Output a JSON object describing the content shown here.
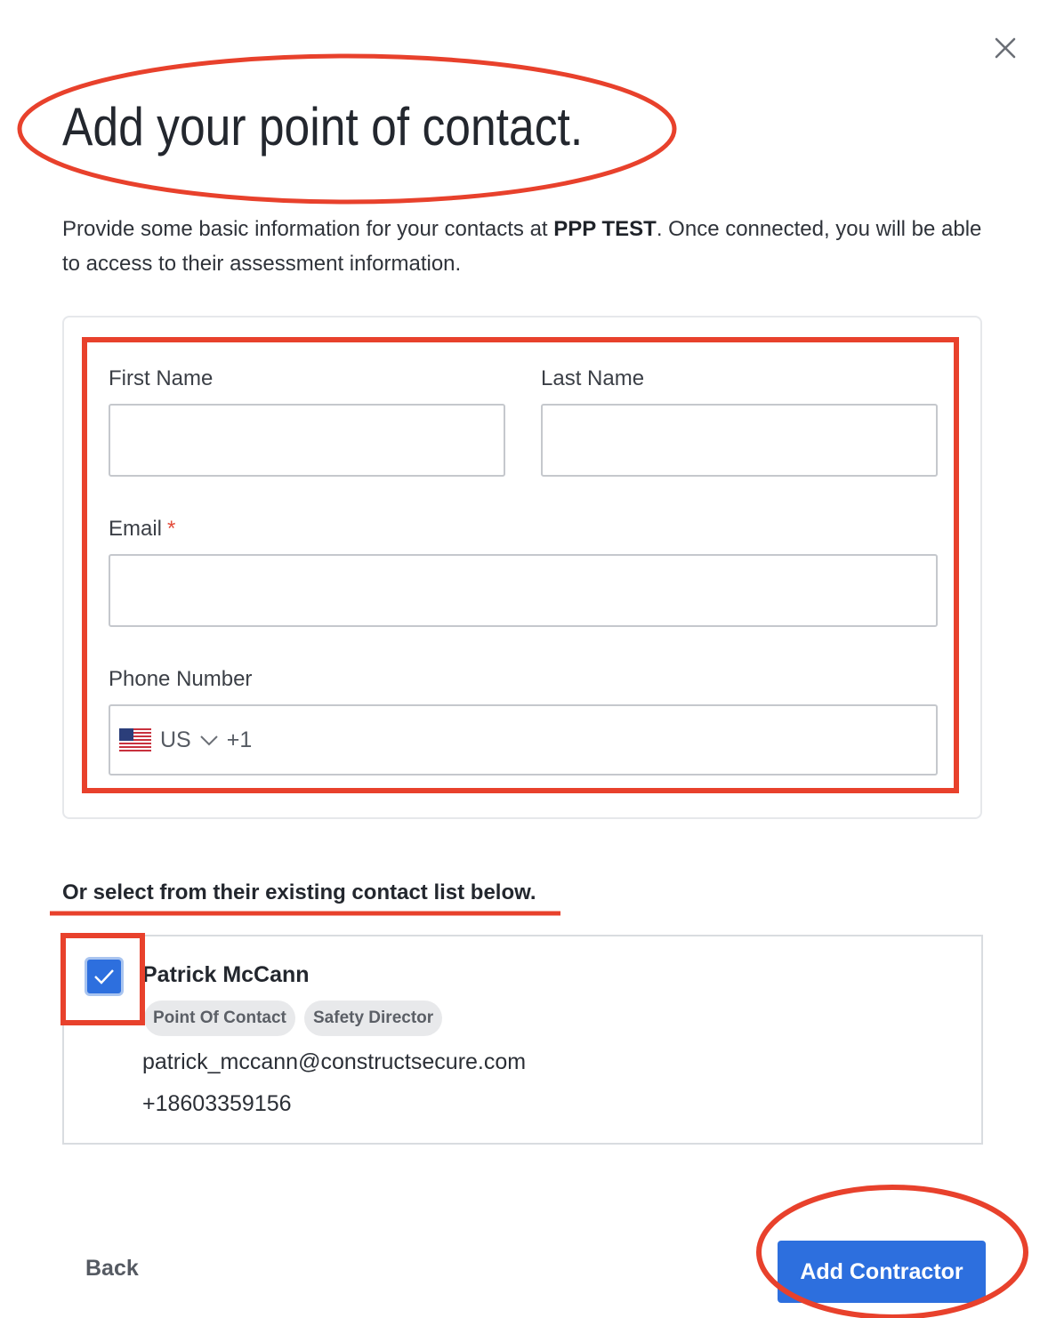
{
  "title": "Add your point of contact.",
  "intro": {
    "before": "Provide some basic information for your contacts at ",
    "company": "PPP TEST",
    "after": ". Once connected, you will be able to access to their assessment information."
  },
  "form": {
    "first_name_label": "First Name",
    "first_name_value": "",
    "last_name_label": "Last Name",
    "last_name_value": "",
    "email_label": "Email",
    "email_required_marker": "*",
    "email_value": "",
    "phone_label": "Phone Number",
    "phone_country": "US",
    "phone_dial_code": "+1"
  },
  "existing": {
    "heading": "Or select from their existing contact list below.",
    "contacts": [
      {
        "name": "Patrick McCann",
        "checked": true,
        "roles": [
          "Point Of Contact",
          "Safety Director"
        ],
        "email": "patrick_mccann@constructsecure.com",
        "phone": "+18603359156"
      }
    ]
  },
  "actions": {
    "back": "Back",
    "submit": "Add Contractor"
  },
  "colors": {
    "primary": "#2d6fde",
    "annotation": "#e8412c",
    "required": "#e34b3a"
  },
  "icons": [
    "close-icon",
    "us-flag-icon",
    "chevron-down-icon",
    "checkmark-icon"
  ]
}
